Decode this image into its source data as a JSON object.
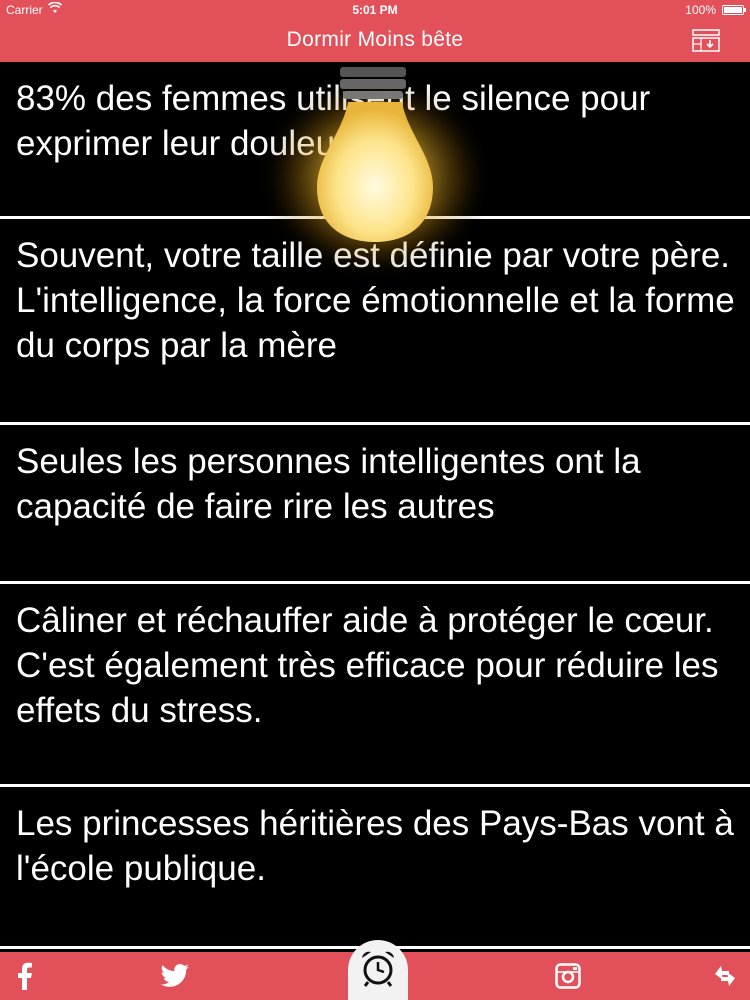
{
  "status_bar": {
    "carrier": "Carrier",
    "time": "5:01 PM",
    "battery": "100%"
  },
  "nav": {
    "title": "Dormir Moins bête",
    "menu_icon": "list-download-icon"
  },
  "facts": [
    {
      "text": "83% des femmes utilisent le silence pour exprimer leur douleur."
    },
    {
      "text": "Souvent, votre taille est définie par votre père. L'intelligence, la force émotionnelle et la forme du corps par la mère"
    },
    {
      "text": "Seules les personnes intelligentes ont la capacité de faire rire les autres"
    },
    {
      "text": "Câliner et réchauffer aide à protéger le cœur. C'est également très efficace pour réduire les effets du stress."
    },
    {
      "text": "Les princesses héritières des Pays-Bas vont à l'école publique."
    }
  ],
  "tabbar": {
    "items": [
      "facebook-icon",
      "twitter-icon",
      "alarm-clock-icon",
      "instagram-icon",
      "refresh-icon"
    ]
  },
  "colors": {
    "accent": "#e2515a",
    "background": "#000000",
    "text": "#ffffff"
  }
}
